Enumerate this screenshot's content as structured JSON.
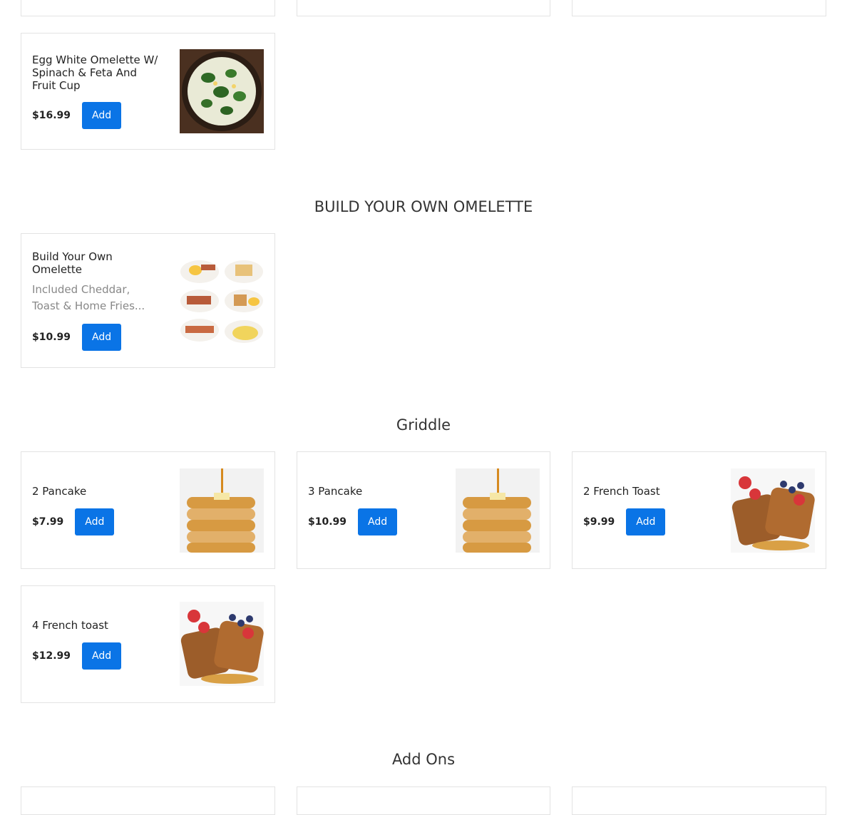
{
  "sections": {
    "omelette_heading": "BUILD YOUR OWN OMELETTE",
    "griddle_heading": "Griddle",
    "addons_heading": "Add Ons"
  },
  "items": {
    "egg_white": {
      "name": "Egg White Omelette W/ Spinach & Feta And Fruit Cup",
      "price": "$16.99",
      "add": "Add"
    },
    "build_omelette": {
      "name": "Build Your Own Omelette",
      "desc": "Included Cheddar, Toast & Home Fries...",
      "price": "$10.99",
      "add": "Add"
    },
    "pancake2": {
      "name": "2 Pancake",
      "price": "$7.99",
      "add": "Add"
    },
    "pancake3": {
      "name": "3 Pancake",
      "price": "$10.99",
      "add": "Add"
    },
    "french2": {
      "name": "2 French Toast",
      "price": "$9.99",
      "add": "Add"
    },
    "french4": {
      "name": "4 French toast",
      "price": "$12.99",
      "add": "Add"
    }
  },
  "colors": {
    "accent": "#0a74e6",
    "border": "#e3e3e3"
  }
}
